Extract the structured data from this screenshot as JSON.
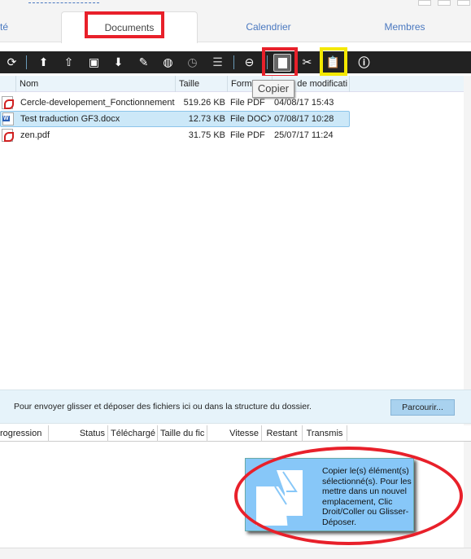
{
  "tabs": [
    {
      "label": "té"
    },
    {
      "label": "Documents"
    },
    {
      "label": "Calendrier"
    },
    {
      "label": "Membres"
    }
  ],
  "toolbar": {
    "icons": [
      "refresh-icon",
      "upload-icon",
      "upload-new-icon",
      "new-folder-icon",
      "download-icon",
      "edit-icon",
      "web-icon",
      "history-icon",
      "notes-icon",
      "delete-icon",
      "copy-icon",
      "cut-icon",
      "paste-icon",
      "info-icon"
    ],
    "copy_tooltip": "Copier"
  },
  "file_table": {
    "headers": [
      "Nom",
      "Taille",
      "Format",
      "Date de modificati"
    ],
    "rows": [
      {
        "type": "pdf",
        "name": "Cercle-developement_Fonctionnement",
        "size": "519.26 KB",
        "format": "File PDF",
        "date": "04/08/17 15:43"
      },
      {
        "type": "doc",
        "name": "Test traduction GF3.docx",
        "size": "12.73 KB",
        "format": "File DOCX",
        "date": "07/08/17 10:28",
        "selected": true
      },
      {
        "type": "pdf",
        "name": "zen.pdf",
        "size": "31.75 KB",
        "format": "File PDF",
        "date": "25/07/17 11:24"
      }
    ]
  },
  "upload": {
    "text": "Pour envoyer glisser et déposer des fichiers ici ou dans la structure du dossier.",
    "browse_label": "Parcourir..."
  },
  "progress_headers": [
    "rogression",
    "Status",
    "Téléchargé",
    "Taille du fic",
    "Vitesse",
    "Restant",
    "Transmis"
  ],
  "help_tip": {
    "text": "Copier le(s) élément(s) sélectionné(s). Pour les mettre dans un nouvel emplacement, Clic Droit/Coller ou Glisser-Déposer."
  },
  "colors": {
    "annotation_red": "#e8202a",
    "annotation_yellow": "#f4e800",
    "toolbar_bg": "#222222",
    "tip_bg": "#87c7f8"
  }
}
